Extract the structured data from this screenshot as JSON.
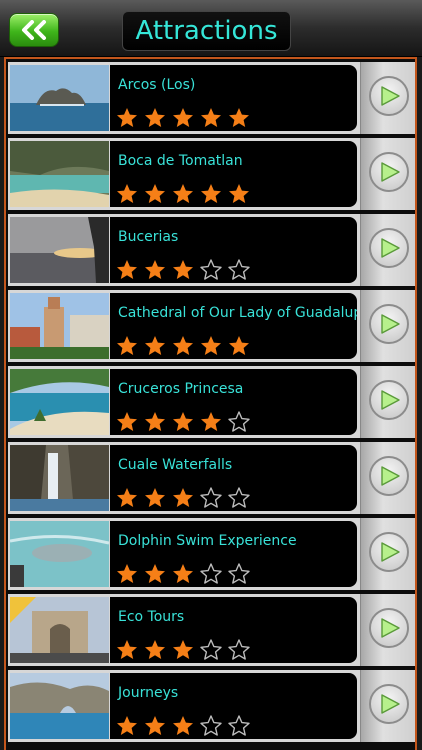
{
  "header": {
    "title": "Attractions"
  },
  "colors": {
    "title_text": "#35e6d8",
    "item_text": "#39e2d8",
    "star_fill": "#f57f17",
    "frame": "#c3561c"
  },
  "icons": {
    "back": "double-chevron-left-icon",
    "go": "play-arrow-icon",
    "star": "star-icon"
  },
  "attractions": [
    {
      "name": "Arcos (Los)",
      "rating": 5
    },
    {
      "name": "Boca de Tomatlan",
      "rating": 5
    },
    {
      "name": "Bucerias",
      "rating": 3
    },
    {
      "name": "Cathedral of Our Lady of Guadalupe",
      "rating": 5
    },
    {
      "name": "Cruceros Princesa",
      "rating": 4
    },
    {
      "name": "Cuale Waterfalls",
      "rating": 3
    },
    {
      "name": "Dolphin Swim Experience",
      "rating": 3
    },
    {
      "name": "Eco Tours",
      "rating": 3
    },
    {
      "name": "Journeys",
      "rating": 3
    }
  ]
}
